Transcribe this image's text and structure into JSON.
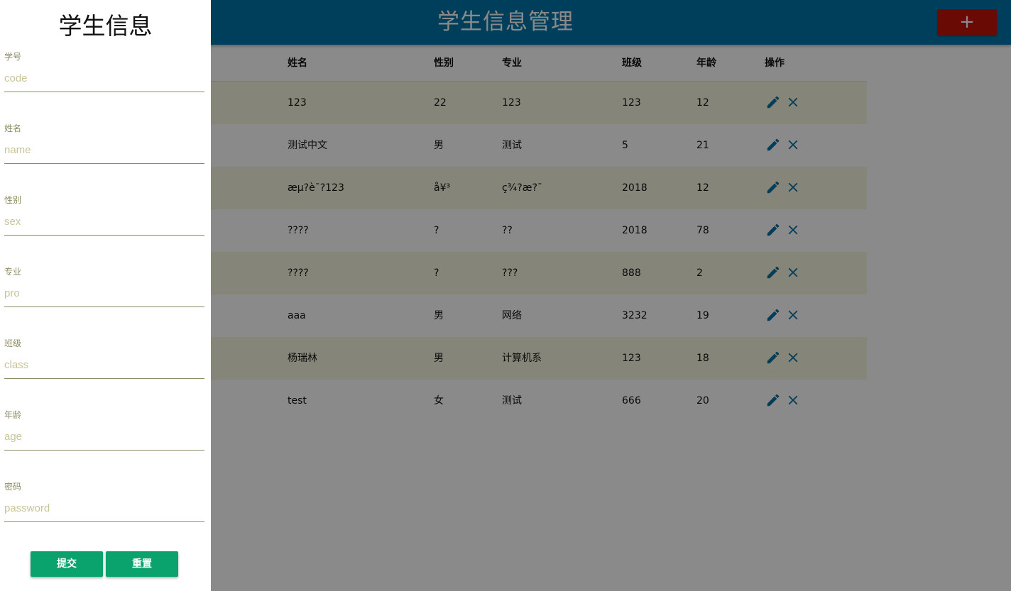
{
  "header": {
    "title": "学生信息管理",
    "add_label": "+"
  },
  "table": {
    "columns": {
      "name": "姓名",
      "sex": "性别",
      "pro": "专业",
      "class": "班级",
      "age": "年龄",
      "op": "操作"
    },
    "rows": [
      {
        "name": "123",
        "sex": "22",
        "pro": "123",
        "class": "123",
        "age": "12"
      },
      {
        "name": "测试中文",
        "sex": "男",
        "pro": "测试",
        "class": "5",
        "age": "21"
      },
      {
        "name": "æµ?è¯?123",
        "sex": "å¥³",
        "pro": "ç¾?æ?¯",
        "class": "2018",
        "age": "12"
      },
      {
        "name": "????",
        "sex": "?",
        "pro": "??",
        "class": "2018",
        "age": "78"
      },
      {
        "name": "????",
        "sex": "?",
        "pro": "???",
        "class": "888",
        "age": "2"
      },
      {
        "name": "aaa",
        "sex": "男",
        "pro": "网络",
        "class": "3232",
        "age": "19"
      },
      {
        "name": "杨瑞林",
        "sex": "男",
        "pro": "计算机系",
        "class": "123",
        "age": "18"
      },
      {
        "name": "test",
        "sex": "女",
        "pro": "测试",
        "class": "666",
        "age": "20"
      }
    ],
    "icons": {
      "edit": "pencil-icon",
      "delete": "close-icon"
    }
  },
  "drawer": {
    "title": "学生信息",
    "fields": [
      {
        "label": "学号",
        "placeholder": "code",
        "value": ""
      },
      {
        "label": "姓名",
        "placeholder": "name",
        "value": ""
      },
      {
        "label": "性别",
        "placeholder": "sex",
        "value": ""
      },
      {
        "label": "专业",
        "placeholder": "pro",
        "value": ""
      },
      {
        "label": "班级",
        "placeholder": "class",
        "value": ""
      },
      {
        "label": "年龄",
        "placeholder": "age",
        "value": ""
      },
      {
        "label": "密码",
        "placeholder": "password",
        "value": ""
      }
    ],
    "submit_label": "提交",
    "reset_label": "重置"
  },
  "colors": {
    "app_bar": "#0075a8",
    "add_button": "#c4140a",
    "row_stripe": "#f7f5e1",
    "action_icon": "#0a6fa3",
    "form_button": "#0aa36e",
    "field_label": "#8d8a63"
  }
}
